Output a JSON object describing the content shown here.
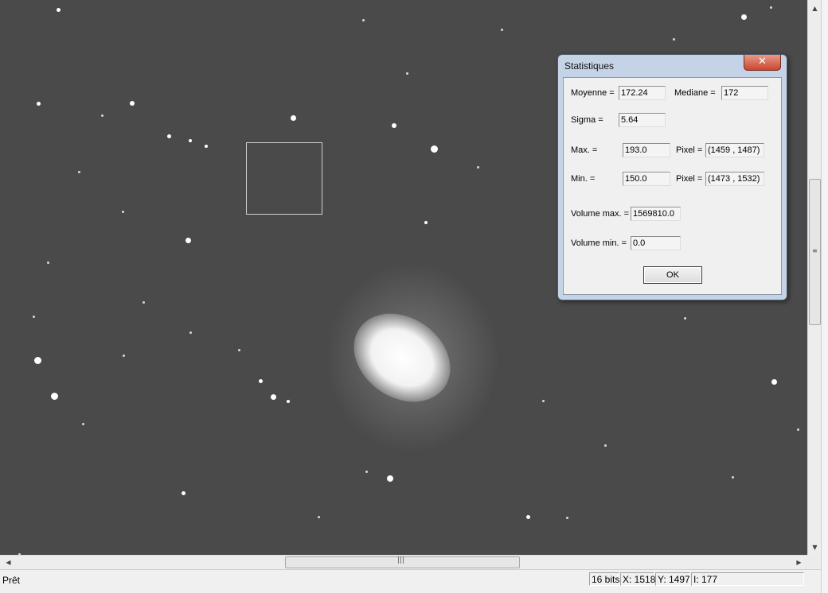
{
  "status": {
    "text": "Prêt",
    "bits": "16 bits",
    "x": "X: 1518",
    "y": "Y: 1497",
    "intensity": "I: 177"
  },
  "dialog": {
    "title": "Statistiques",
    "close_icon": "close-icon",
    "moyenne_label": "Moyenne =",
    "moyenne_value": "172.24",
    "mediane_label": "Mediane =",
    "mediane_value": "172",
    "sigma_label": "Sigma =",
    "sigma_value": "5.64",
    "max_label": "Max. =",
    "max_value": "193.0",
    "max_pixel_label": "Pixel =",
    "max_pixel_value": "(1459 , 1487)",
    "min_label": "Min. =",
    "min_value": "150.0",
    "min_pixel_label": "Pixel =",
    "min_pixel_value": "(1473 , 1532)",
    "volmax_label": "Volume max. =",
    "volmax_value": "1569810.0",
    "volmin_label": "Volume min. =",
    "volmin_value": "0.0",
    "ok_label": "OK"
  },
  "scrollbars": {
    "up_icon": "scroll-up-icon",
    "down_icon": "scroll-down-icon",
    "left_icon": "scroll-left-icon",
    "right_icon": "scroll-right-icon"
  },
  "colors": {
    "sky": "#4a4a4a",
    "dialog_frame": "#c5d3e6",
    "close_button": "#c8472f"
  }
}
